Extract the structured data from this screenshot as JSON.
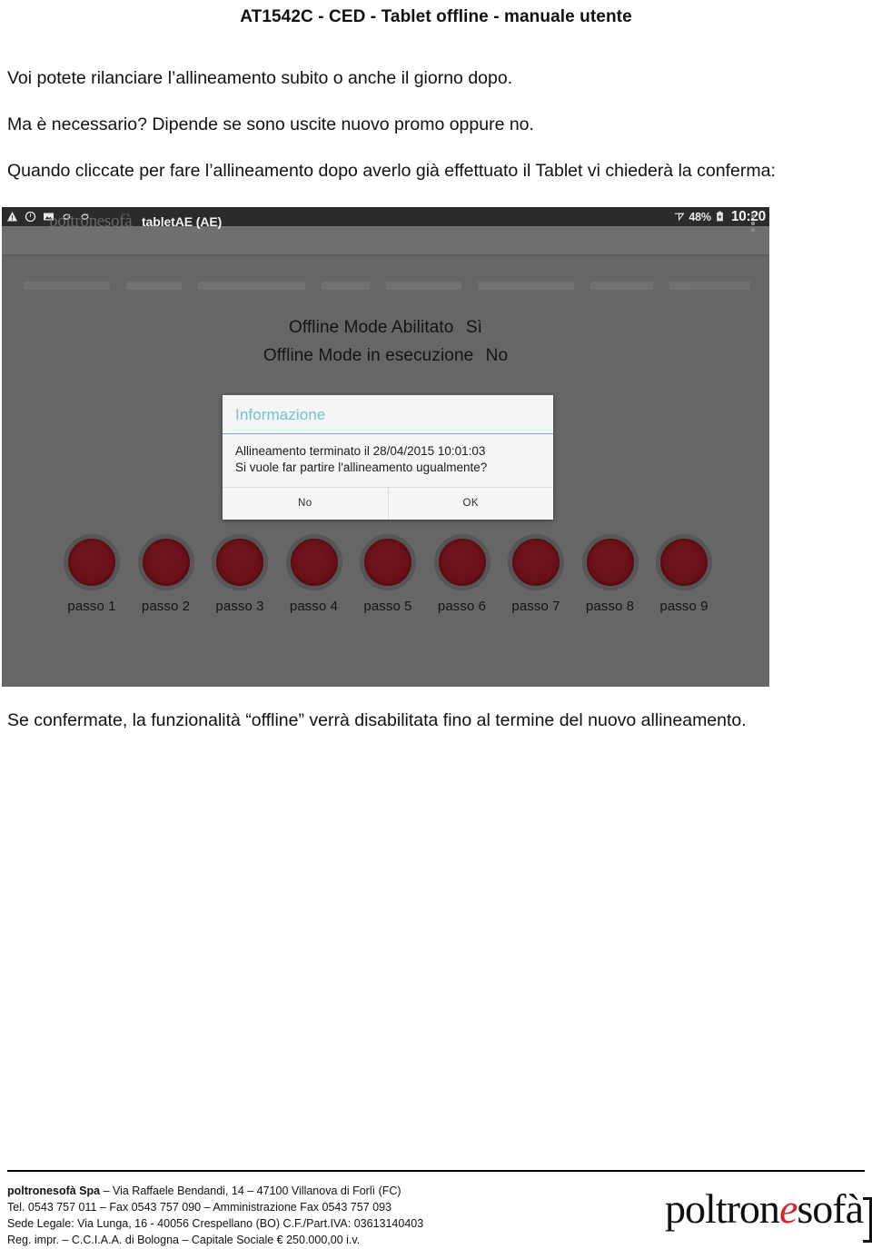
{
  "document": {
    "title": "AT1542C - CED - Tablet offline - manuale utente",
    "paragraphs": [
      "Voi potete rilanciare l’allineamento subito o anche il giorno dopo.",
      "Ma è necessario? Dipende se sono uscite nuovo promo oppure no.",
      "Quando cliccate per fare l’allineamento dopo averlo già effettuato il Tablet vi chiederà la conferma:",
      "Se confermate, la funzionalità “offline” verrà disabilitata fino al termine del nuovo allineamento."
    ]
  },
  "screenshot": {
    "statusbar": {
      "icons": [
        "warning-triangle-icon",
        "alarm-clock-icon",
        "image-icon",
        "sync-icon",
        "sync-icon"
      ],
      "wifi_icon": "wifi-icon",
      "battery_percent": "48%",
      "battery_icon": "battery-icon",
      "clock": "10:20"
    },
    "appbar": {
      "logo": "poltronesofà",
      "title": "tabletAE (AE)",
      "overflow_icon": "overflow-menu-icon"
    },
    "status_lines": [
      {
        "label": "Offline Mode Abilitato",
        "value": "Sì"
      },
      {
        "label": "Offline Mode in esecuzione",
        "value": "No"
      }
    ],
    "dialog": {
      "title": "Informazione",
      "title_color": "#72c3cd",
      "body_line_1": "Allineamento terminato il 28/04/2015 10:01:03",
      "body_line_2": "Si vuole far partire l'allineamento ugualmente?",
      "button_no": "No",
      "button_ok": "OK"
    },
    "steps": [
      {
        "label": "passo 1"
      },
      {
        "label": "passo 2"
      },
      {
        "label": "passo 3"
      },
      {
        "label": "passo 4"
      },
      {
        "label": "passo 5"
      },
      {
        "label": "passo 6"
      },
      {
        "label": "passo 7"
      },
      {
        "label": "passo 8"
      },
      {
        "label": "passo 9"
      }
    ],
    "colors": {
      "background": "#666666",
      "statusbar": "#2b2b2b",
      "appbar": "#6f6f6f",
      "step_dot": "#6a1019",
      "step_ring": "#565656",
      "dialog_surface": "#f4f5f5"
    }
  },
  "footer": {
    "line_1_bold": "poltronesofà Spa",
    "line_1_rest": " – Via Raffaele Bendandi, 14 – 47100 Villanova di Forlì (FC)",
    "line_2": "Tel. 0543 757 011 – Fax 0543 757 090 – Amministrazione Fax 0543 757 093",
    "line_3": "Sede Legale: Via Lunga, 16 - 40056 Crespellano (BO) C.F./Part.IVA: 03613140403",
    "line_4": "Reg. impr. – C.C.I.A.A. di Bologna – Capitale Sociale € 250.000,00 i.v.",
    "logo_part_1": "poltron",
    "logo_accent": "e",
    "logo_part_2": "sofà",
    "logo_accent_color": "#d8232a"
  }
}
